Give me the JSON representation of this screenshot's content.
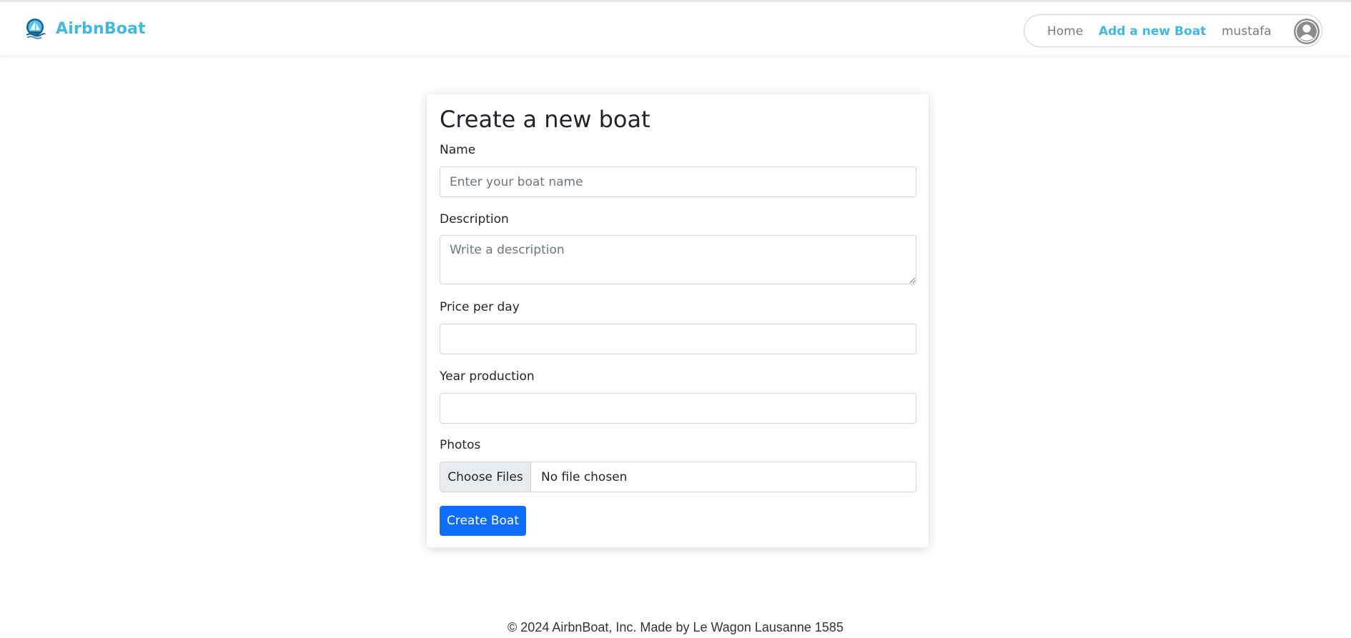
{
  "navbar": {
    "brand_name": "AirbnBoat",
    "brand_icon": "boat-logo-icon",
    "links": {
      "home": "Home",
      "add_boat": "Add a new Boat",
      "username": "mustafa"
    },
    "avatar_icon": "user-avatar-icon"
  },
  "form": {
    "title": "Create a new boat",
    "name": {
      "label": "Name",
      "placeholder": "Enter your boat name",
      "value": ""
    },
    "description": {
      "label": "Description",
      "placeholder": "Write a description",
      "value": ""
    },
    "price": {
      "label": "Price per day",
      "value": ""
    },
    "year": {
      "label": "Year production",
      "value": ""
    },
    "photos": {
      "label": "Photos",
      "button_label": "Choose Files",
      "status": "No file chosen"
    },
    "submit_label": "Create Boat"
  },
  "footer": {
    "text": "© 2024 AirbnBoat, Inc. Made by Le Wagon Lausanne 1585"
  },
  "colors": {
    "brand": "#3fb8e6",
    "primary_button": "#0d6efd",
    "nav_text": "#7a7a7a"
  }
}
